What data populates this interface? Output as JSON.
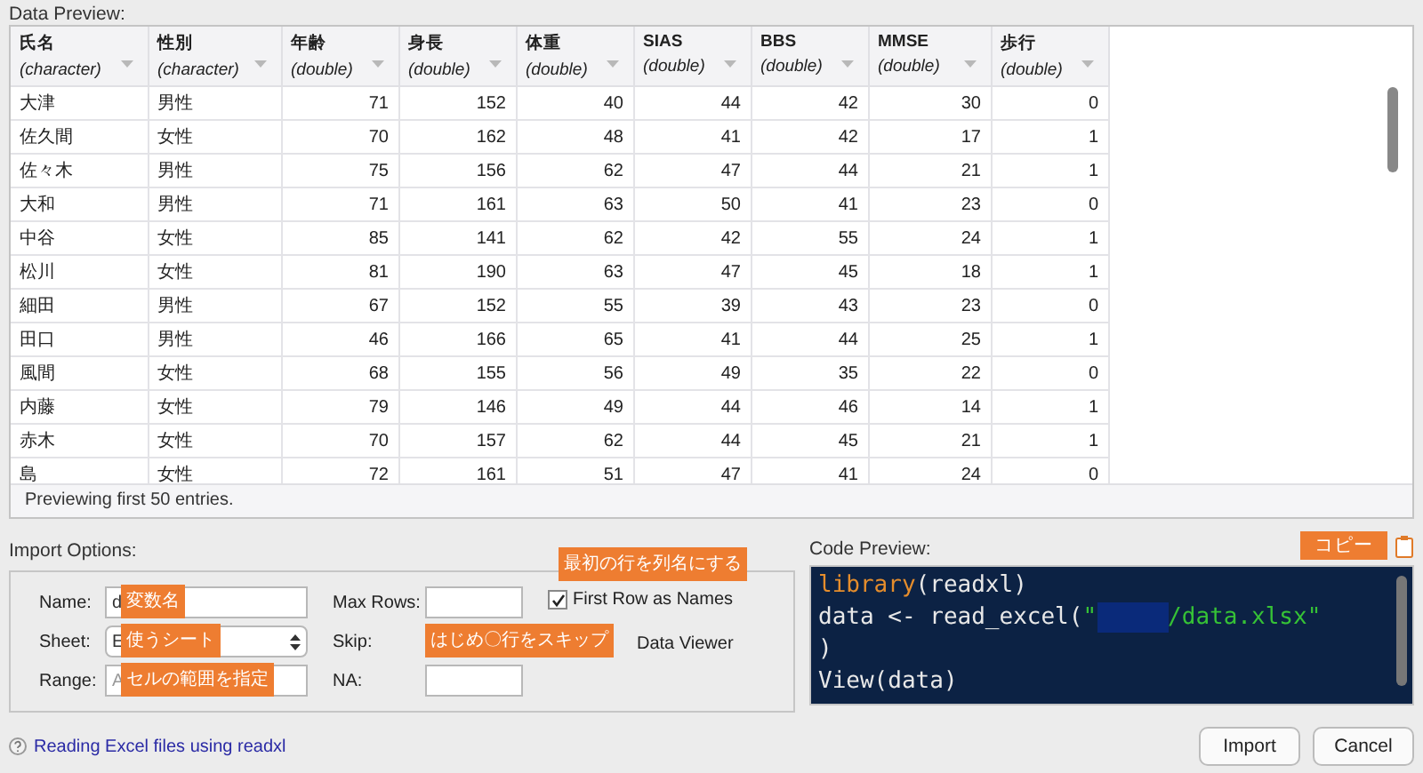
{
  "data_preview": {
    "label": "Data Preview:",
    "columns": [
      {
        "name": "氏名",
        "type": "(character)",
        "kind": "text"
      },
      {
        "name": "性別",
        "type": "(character)",
        "kind": "text"
      },
      {
        "name": "年齢",
        "type": "(double)",
        "kind": "number"
      },
      {
        "name": "身長",
        "type": "(double)",
        "kind": "number"
      },
      {
        "name": "体重",
        "type": "(double)",
        "kind": "number"
      },
      {
        "name": "SIAS",
        "type": "(double)",
        "kind": "number"
      },
      {
        "name": "BBS",
        "type": "(double)",
        "kind": "number"
      },
      {
        "name": "MMSE",
        "type": "(double)",
        "kind": "number"
      },
      {
        "name": "歩行",
        "type": "(double)",
        "kind": "number"
      }
    ],
    "rows": [
      [
        "大津",
        "男性",
        "71",
        "152",
        "40",
        "44",
        "42",
        "30",
        "0"
      ],
      [
        "佐久間",
        "女性",
        "70",
        "162",
        "48",
        "41",
        "42",
        "17",
        "1"
      ],
      [
        "佐々木",
        "男性",
        "75",
        "156",
        "62",
        "47",
        "44",
        "21",
        "1"
      ],
      [
        "大和",
        "男性",
        "71",
        "161",
        "63",
        "50",
        "41",
        "23",
        "0"
      ],
      [
        "中谷",
        "女性",
        "85",
        "141",
        "62",
        "42",
        "55",
        "24",
        "1"
      ],
      [
        "松川",
        "女性",
        "81",
        "190",
        "63",
        "47",
        "45",
        "18",
        "1"
      ],
      [
        "細田",
        "男性",
        "67",
        "152",
        "55",
        "39",
        "43",
        "23",
        "0"
      ],
      [
        "田口",
        "男性",
        "46",
        "166",
        "65",
        "41",
        "44",
        "25",
        "1"
      ],
      [
        "風間",
        "女性",
        "68",
        "155",
        "56",
        "49",
        "35",
        "22",
        "0"
      ],
      [
        "内藤",
        "女性",
        "79",
        "146",
        "49",
        "44",
        "46",
        "14",
        "1"
      ],
      [
        "赤木",
        "女性",
        "70",
        "157",
        "62",
        "44",
        "45",
        "21",
        "1"
      ],
      [
        "島",
        "女性",
        "72",
        "161",
        "51",
        "47",
        "41",
        "24",
        "0"
      ]
    ],
    "footer": "Previewing first 50 entries."
  },
  "import_options": {
    "label": "Import Options:",
    "left_fields": [
      {
        "label": "Name:",
        "kind": "input",
        "value": "d",
        "annotation": "変数名"
      },
      {
        "label": "Sheet:",
        "kind": "select",
        "value": "E",
        "annotation": "使うシート"
      },
      {
        "label": "Range:",
        "kind": "input",
        "placeholder": "A",
        "annotation": "セルの範囲を指定"
      }
    ],
    "middle_fields": [
      {
        "label": "Max Rows:",
        "kind": "input"
      },
      {
        "label": "Skip:",
        "kind": "none",
        "annotation": "はじめ〇行をスキップ"
      },
      {
        "label": "NA:",
        "kind": "input"
      }
    ],
    "first_row_as_names": {
      "label": "First Row as Names",
      "checked": true,
      "annotation": "最初の行を列名にする"
    },
    "data_viewer_label": "Data Viewer"
  },
  "code_preview": {
    "label": "Code Preview:",
    "copy_annotation": "コピー",
    "lines": [
      [
        {
          "kind": "function",
          "text": "library"
        },
        {
          "kind": "plain",
          "text": "(readxl)"
        }
      ],
      [
        {
          "kind": "plain",
          "text": "data <- read_excel("
        },
        {
          "kind": "string",
          "text": "\""
        },
        {
          "kind": "redaction"
        },
        {
          "kind": "string",
          "text": "/data.xlsx\""
        }
      ],
      [
        {
          "kind": "plain",
          "text": ")"
        }
      ],
      [
        {
          "kind": "plain",
          "text": "View(data)"
        }
      ]
    ]
  },
  "help_link": "Reading Excel files using readxl",
  "buttons": [
    {
      "label": "Import"
    },
    {
      "label": "Cancel"
    }
  ]
}
